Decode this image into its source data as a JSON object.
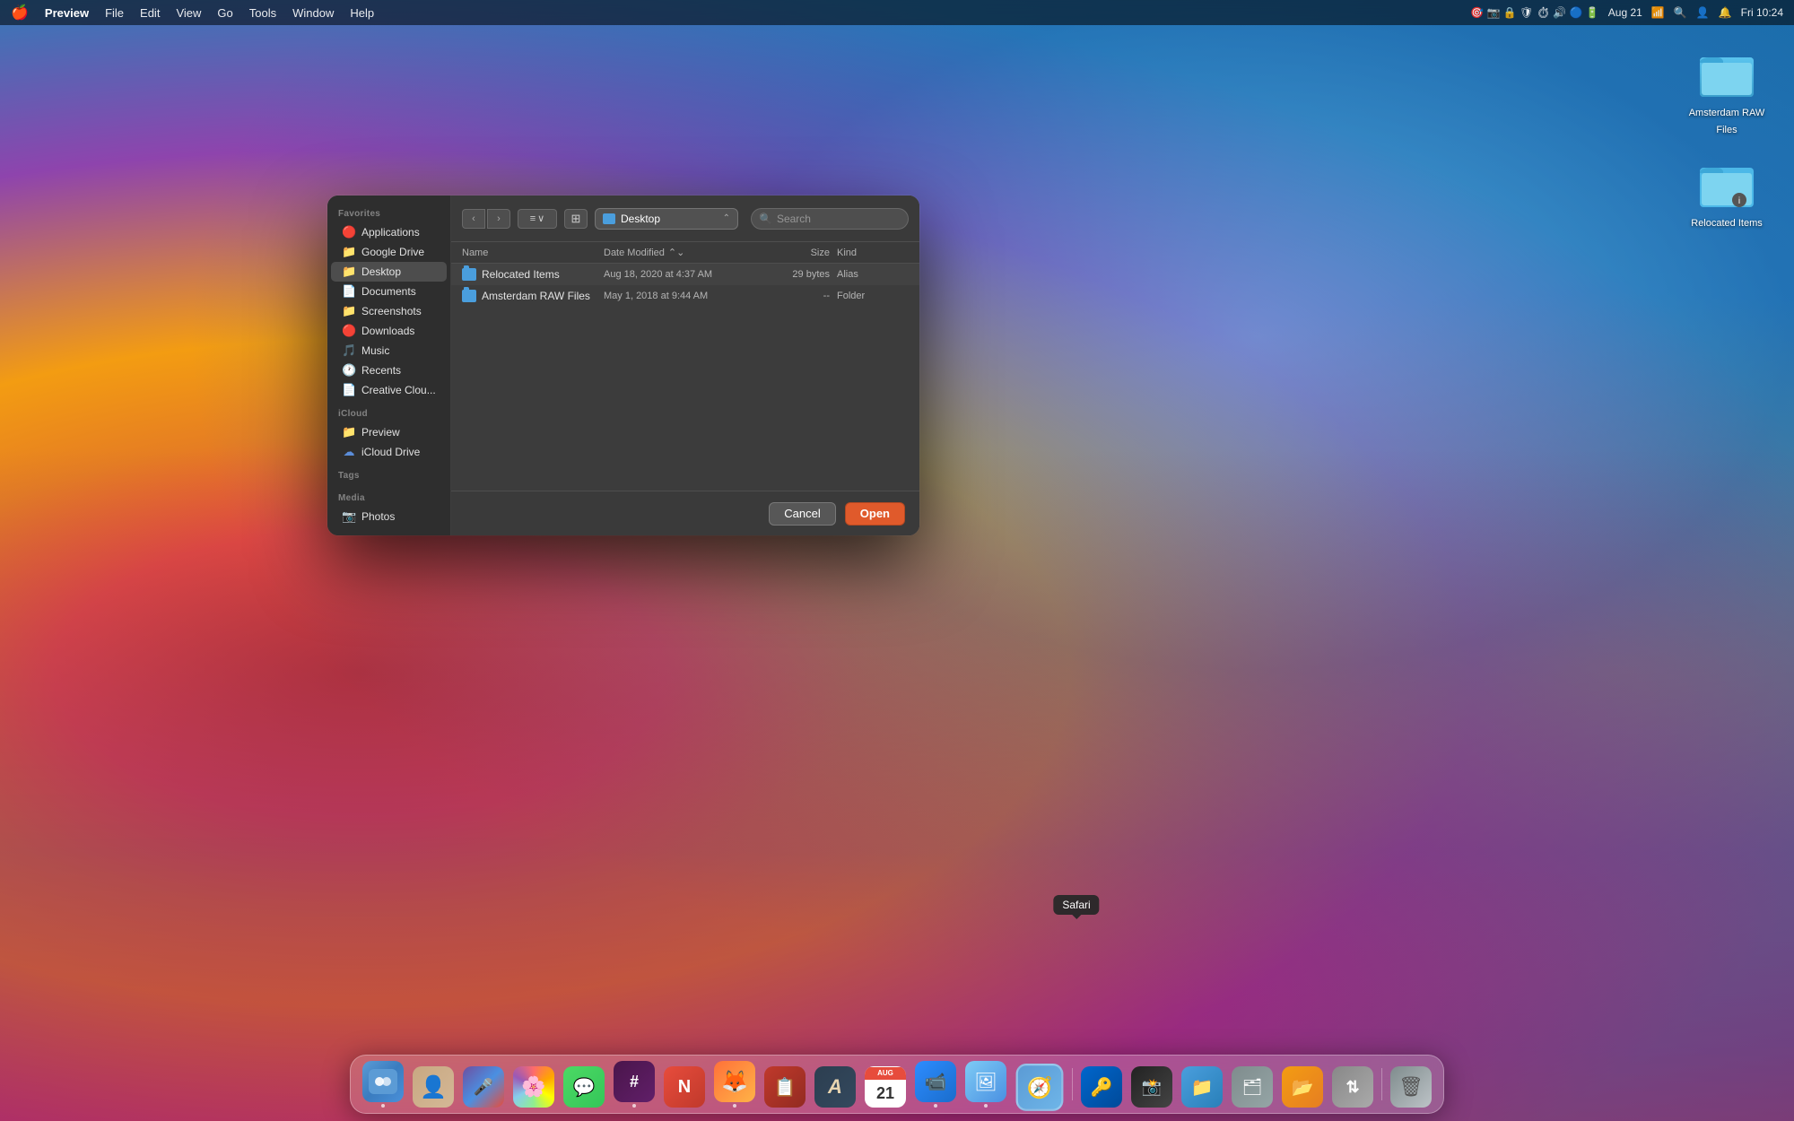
{
  "menubar": {
    "apple": "🍎",
    "app_name": "Preview",
    "items": [
      "File",
      "Edit",
      "View",
      "Go",
      "Tools",
      "Window",
      "Help"
    ],
    "right_items": [
      "Aug 21",
      "Fri 10:24"
    ]
  },
  "desktop_icons": [
    {
      "id": "amsterdam-raw-files",
      "label": "Amsterdam RAW\nFiles",
      "label_line1": "Amsterdam RAW",
      "label_line2": "Files",
      "color": "#4cb8e8"
    },
    {
      "id": "relocated-items",
      "label": "Relocated Items",
      "label_line1": "Relocated Items",
      "label_line2": "",
      "color": "#4cb8e8"
    }
  ],
  "dialog": {
    "sidebar": {
      "favorites_label": "Favorites",
      "items": [
        {
          "id": "applications",
          "label": "Applications",
          "icon": "🔴",
          "icon_type": "red"
        },
        {
          "id": "google-drive",
          "label": "Google Drive",
          "icon": "📁",
          "icon_type": "blue"
        },
        {
          "id": "desktop",
          "label": "Desktop",
          "icon": "📁",
          "icon_type": "brown",
          "active": true
        },
        {
          "id": "documents",
          "label": "Documents",
          "icon": "📄",
          "icon_type": "red"
        },
        {
          "id": "screenshots",
          "label": "Screenshots",
          "icon": "📁",
          "icon_type": "blue"
        },
        {
          "id": "downloads",
          "label": "Downloads",
          "icon": "🔴",
          "icon_type": "orange"
        },
        {
          "id": "music",
          "label": "Music",
          "icon": "🎵",
          "icon_type": "purple"
        },
        {
          "id": "recents",
          "label": "Recents",
          "icon": "🕐",
          "icon_type": "red"
        },
        {
          "id": "creative-cloud",
          "label": "Creative Clou...",
          "icon": "📄",
          "icon_type": "red"
        }
      ],
      "icloud_label": "iCloud",
      "icloud_items": [
        {
          "id": "preview",
          "label": "Preview",
          "icon": "📁",
          "icon_type": "blue"
        },
        {
          "id": "icloud-drive",
          "label": "iCloud Drive",
          "icon": "☁",
          "icon_type": "cloud"
        }
      ],
      "tags_label": "Tags",
      "media_label": "Media",
      "media_items": [
        {
          "id": "photos",
          "label": "Photos",
          "icon": "📷",
          "icon_type": "teal"
        }
      ]
    },
    "toolbar": {
      "back_label": "‹",
      "forward_label": "›",
      "view_label": "≡ ∨",
      "arrange_label": "⊞",
      "location": "Desktop",
      "search_placeholder": "Search"
    },
    "file_list": {
      "columns": {
        "name": "Name",
        "date_modified": "Date Modified",
        "size": "Size",
        "kind": "Kind"
      },
      "files": [
        {
          "name": "Relocated Items",
          "date_modified": "Aug 18, 2020 at 4:37 AM",
          "size": "29 bytes",
          "kind": "Alias"
        },
        {
          "name": "Amsterdam RAW Files",
          "date_modified": "May 1, 2018 at 9:44 AM",
          "size": "--",
          "kind": "Folder"
        }
      ]
    },
    "buttons": {
      "cancel": "Cancel",
      "open": "Open"
    }
  },
  "safari_tooltip": "Safari",
  "dock": {
    "items": [
      {
        "id": "finder",
        "label": "Finder",
        "css_class": "finder",
        "icon": "🖥",
        "has_dot": true
      },
      {
        "id": "contacts",
        "label": "Contacts",
        "css_class": "contacts",
        "icon": "👤",
        "has_dot": false
      },
      {
        "id": "siri",
        "label": "Siri",
        "css_class": "siri",
        "icon": "🎤",
        "has_dot": false
      },
      {
        "id": "photos-dock",
        "label": "Photos",
        "css_class": "photos",
        "icon": "🌸",
        "has_dot": false
      },
      {
        "id": "messages",
        "label": "Messages",
        "css_class": "messages",
        "icon": "💬",
        "has_dot": false
      },
      {
        "id": "slack",
        "label": "Slack",
        "css_class": "slack",
        "icon": "#",
        "has_dot": true
      },
      {
        "id": "news",
        "label": "News",
        "css_class": "news",
        "icon": "N",
        "has_dot": false
      },
      {
        "id": "firefox",
        "label": "Firefox",
        "css_class": "firefox",
        "icon": "🦊",
        "has_dot": true
      },
      {
        "id": "pockity",
        "label": "Pockity",
        "css_class": "pockity",
        "icon": "📋",
        "has_dot": false
      },
      {
        "id": "font-app",
        "label": "Font App",
        "css_class": "font-app",
        "icon": "A",
        "has_dot": false
      },
      {
        "id": "calendar",
        "label": "Calendar",
        "css_class": "calendar",
        "icon": "📅",
        "has_dot": false
      },
      {
        "id": "zoom",
        "label": "Zoom",
        "css_class": "zoom",
        "icon": "📹",
        "has_dot": true
      },
      {
        "id": "preview-dock",
        "label": "Preview",
        "css_class": "preview-app",
        "icon": "🖼",
        "has_dot": true
      },
      {
        "id": "safari-dock",
        "label": "Safari",
        "css_class": "safari",
        "icon": "🧭",
        "has_dot": false
      },
      {
        "id": "onepass",
        "label": "1Password",
        "css_class": "onepass",
        "icon": "🔑",
        "has_dot": false
      },
      {
        "id": "screenium",
        "label": "Screenium",
        "css_class": "screenium",
        "icon": "📸",
        "has_dot": false
      },
      {
        "id": "files-dock",
        "label": "Files",
        "css_class": "files",
        "icon": "📁",
        "has_dot": false
      },
      {
        "id": "fileicon",
        "label": "FileIcon",
        "css_class": "fileicon",
        "icon": "🗂",
        "has_dot": false
      },
      {
        "id": "folder-mgr",
        "label": "Folder Manager",
        "css_class": "folder-mgr",
        "icon": "📂",
        "has_dot": false
      },
      {
        "id": "filezilla",
        "label": "FileZilla",
        "css_class": "filezilla",
        "icon": "⇅",
        "has_dot": false
      },
      {
        "id": "trash",
        "label": "Trash",
        "css_class": "trash",
        "icon": "🗑",
        "has_dot": false
      }
    ]
  }
}
